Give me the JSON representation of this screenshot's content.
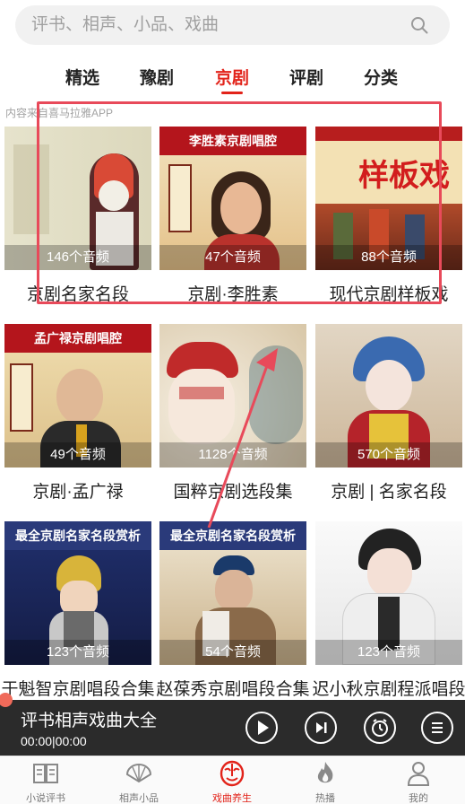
{
  "search": {
    "placeholder": "评书、相声、小品、戏曲"
  },
  "tabs": [
    "精选",
    "豫剧",
    "京剧",
    "评剧",
    "分类"
  ],
  "active_tab": "京剧",
  "source_note": "内容来自喜马拉雅APP",
  "albums": [
    {
      "title": "京剧名家名段",
      "count": "146个音频",
      "banner": ""
    },
    {
      "title": "京剧·李胜素",
      "count": "47个音频",
      "banner": "李胜素京剧唱腔"
    },
    {
      "title": "现代京剧样板戏",
      "count": "88个音频",
      "banner": "样板戏"
    },
    {
      "title": "京剧·孟广禄",
      "count": "49个音频",
      "banner": "孟广禄京剧唱腔"
    },
    {
      "title": "国粹京剧选段集",
      "count": "1128个音频",
      "banner": ""
    },
    {
      "title": "京剧 | 名家名段",
      "count": "570个音频",
      "banner": ""
    },
    {
      "title": "于魁智京剧唱段合集",
      "count": "123个音频",
      "banner": "最全京剧名家名段赏析"
    },
    {
      "title": "赵葆秀京剧唱段合集",
      "count": "54个音频",
      "banner": "最全京剧名家名段赏析"
    },
    {
      "title": "迟小秋京剧程派唱段",
      "count": "123个音频",
      "banner": ""
    }
  ],
  "player": {
    "title": "评书相声戏曲大全",
    "time": "00:00|00:00"
  },
  "bottom_nav": [
    {
      "label": "小说评书",
      "icon": "book-icon"
    },
    {
      "label": "相声小品",
      "icon": "fan-icon"
    },
    {
      "label": "戏曲养生",
      "icon": "opera-mask-icon"
    },
    {
      "label": "热播",
      "icon": "flame-icon"
    },
    {
      "label": "我的",
      "icon": "person-icon"
    }
  ],
  "colors": {
    "accent": "#e2231a",
    "player_bg": "#2b2b2b",
    "highlight": "#e84a5a"
  }
}
